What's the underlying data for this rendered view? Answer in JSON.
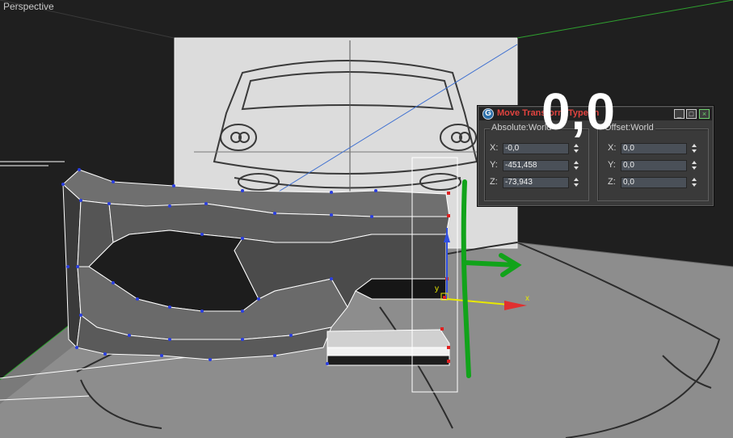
{
  "viewport": {
    "label": "Perspective"
  },
  "annotation": {
    "text": "0,0",
    "circle_color": "#1a2fb0",
    "arrow_color": "#11a31a"
  },
  "dialog": {
    "title": "Move Transform Type-In",
    "absolute": {
      "label": "Absolute:World",
      "x_label": "X:",
      "x_value": "-0,0",
      "y_label": "Y:",
      "y_value": "-451,458",
      "z_label": "Z:",
      "z_value": "-73,943"
    },
    "offset": {
      "label": "Offset:World",
      "x_label": "X:",
      "x_value": "0,0",
      "y_label": "Y:",
      "y_value": "0,0",
      "z_label": "Z:",
      "z_value": "0,0"
    },
    "buttons": {
      "minimize": "_",
      "maximize": "□",
      "close": "×"
    }
  },
  "gizmo": {
    "x_label": "x",
    "y_label": "y"
  },
  "colors": {
    "background": "#1c1c1c",
    "floor": "#8c8c8c",
    "title_red": "#e0433f"
  }
}
